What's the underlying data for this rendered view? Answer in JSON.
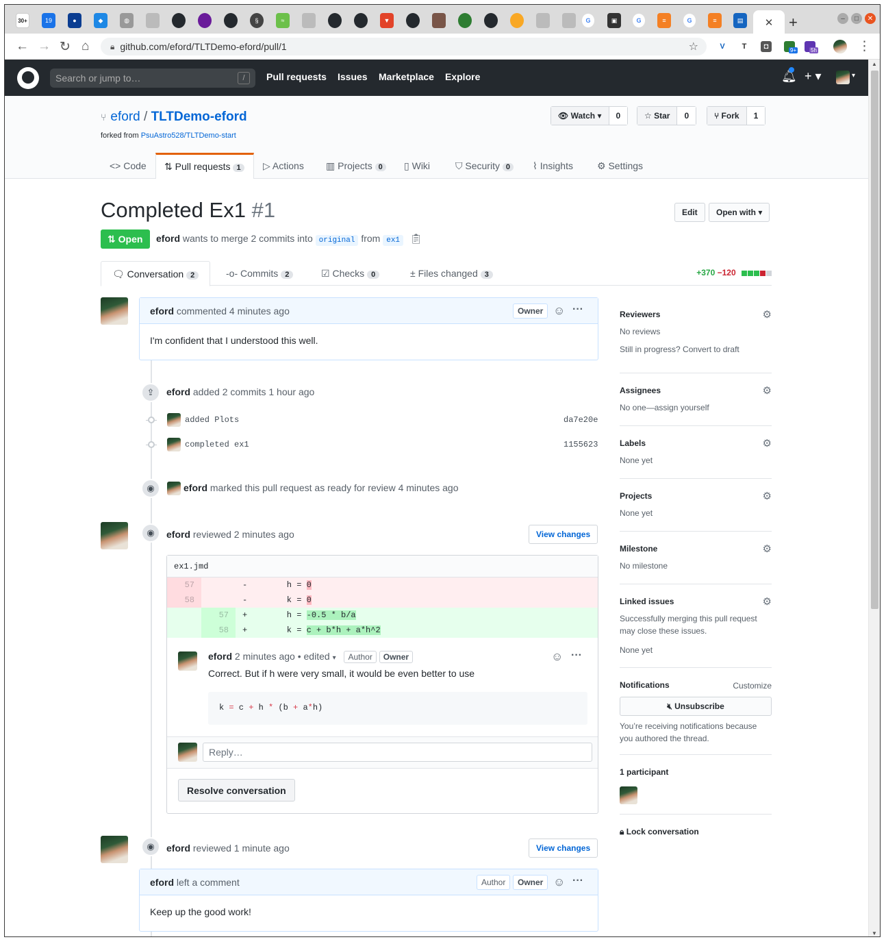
{
  "browser": {
    "url": "github.com/eford/TLTDemo-eford/pull/1",
    "tabs_colors": [
      "#d93025",
      "#1a73e8",
      "#0b3d91",
      "#1e88e5",
      "#888",
      "#888",
      "#24292e",
      "#6a1b9a",
      "#24292e",
      "#333",
      "#6cc04a",
      "#888",
      "#24292e",
      "#24292e",
      "#e24329",
      "#24292e",
      "#795548",
      "#2e7d32",
      "#24292e",
      "#f9a825",
      "#888",
      "#888",
      "#4285f4",
      "#333",
      "#4285f4",
      "#f48024",
      "#4285f4",
      "#f48024",
      "#1565c0"
    ],
    "gmail_badge": "30+",
    "calendar_day": "19",
    "ext_badge1": "9+",
    "ext_badge2": "5h"
  },
  "gh": {
    "search_placeholder": "Search or jump to…",
    "slash": "/",
    "nav": [
      "Pull requests",
      "Issues",
      "Marketplace",
      "Explore"
    ]
  },
  "repo": {
    "owner": "eford",
    "sep": "/",
    "name": "TLTDemo-eford",
    "forked_prefix": "forked from ",
    "forked_from": "PsuAstro528/TLTDemo-start",
    "watch": {
      "label": "Watch",
      "count": "0"
    },
    "star": {
      "label": "Star",
      "count": "0"
    },
    "fork": {
      "label": "Fork",
      "count": "1"
    },
    "tabs": {
      "code": "Code",
      "pulls": "Pull requests",
      "pulls_count": "1",
      "actions": "Actions",
      "projects": "Projects",
      "projects_count": "0",
      "wiki": "Wiki",
      "security": "Security",
      "security_count": "0",
      "insights": "Insights",
      "settings": "Settings"
    }
  },
  "pr": {
    "title": "Completed Ex1",
    "number": "#1",
    "state": "Open",
    "author": "eford",
    "meta_mid": " wants to merge 2 commits into ",
    "base": "original",
    "meta_from": " from ",
    "head": "ex1",
    "edit": "Edit",
    "open_with": "Open with",
    "tabs": {
      "conversation": "Conversation",
      "conversation_count": "2",
      "commits": "Commits",
      "commits_count": "2",
      "checks": "Checks",
      "checks_count": "0",
      "files": "Files changed",
      "files_count": "3"
    },
    "additions": "+370",
    "deletions": "−120"
  },
  "timeline": {
    "comment1": {
      "author": "eford",
      "action": " commented 4 minutes ago",
      "owner": "Owner",
      "body": "I'm confident that I understood this well."
    },
    "commits_event": {
      "author": "eford",
      "text": " added 2 commits 1 hour ago"
    },
    "commits": [
      {
        "msg": "added Plots",
        "sha": "da7e20e"
      },
      {
        "msg": "completed ex1",
        "sha": "1155623"
      }
    ],
    "ready_event": {
      "author": "eford",
      "text": " marked this pull request as ready for review 4 minutes ago"
    },
    "review1": {
      "author": "eford",
      "text": " reviewed 2 minutes ago",
      "view": "View changes",
      "file": "ex1.jmd",
      "diff": [
        {
          "old": "57",
          "new": "",
          "sign": "-",
          "pre": "    h = ",
          "hl": "0",
          "kind": "del"
        },
        {
          "old": "58",
          "new": "",
          "sign": "-",
          "pre": "    k = ",
          "hl": "0",
          "kind": "del"
        },
        {
          "old": "",
          "new": "57",
          "sign": "+",
          "pre": "    h = ",
          "hl": "-0.5 * b/a",
          "kind": "add"
        },
        {
          "old": "",
          "new": "58",
          "sign": "+",
          "pre": "    k = ",
          "hl": "c + b*h + a*h^2",
          "kind": "add"
        }
      ],
      "comment_author": "eford",
      "comment_meta": " 2 minutes ago • edited ",
      "author_tag": "Author",
      "owner_tag": "Owner",
      "comment_body": "Correct. But if h were very small, it would be even better to use",
      "code": "k = c + h * (b + a*h)",
      "reply_placeholder": "Reply…",
      "resolve": "Resolve conversation"
    },
    "review2": {
      "author": "eford",
      "text": " reviewed 1 minute ago",
      "view": "View changes",
      "comment_author": "eford",
      "comment_action": " left a comment",
      "author_tag": "Author",
      "owner_tag": "Owner",
      "body": "Keep up the good work!"
    }
  },
  "sidebar": {
    "reviewers": {
      "title": "Reviewers",
      "line1": "No reviews",
      "line2": "Still in progress? Convert to draft"
    },
    "assignees": {
      "title": "Assignees",
      "line1": "No one—assign yourself"
    },
    "labels": {
      "title": "Labels",
      "line1": "None yet"
    },
    "projects": {
      "title": "Projects",
      "line1": "None yet"
    },
    "milestone": {
      "title": "Milestone",
      "line1": "No milestone"
    },
    "linked": {
      "title": "Linked issues",
      "line1": "Successfully merging this pull request may close these issues.",
      "line2": "None yet"
    },
    "notifications": {
      "title": "Notifications",
      "customize": "Customize",
      "button": "Unsubscribe",
      "text": "You’re receiving notifications because you authored the thread."
    },
    "participants": {
      "title": "1 participant"
    },
    "lock": "Lock conversation"
  }
}
